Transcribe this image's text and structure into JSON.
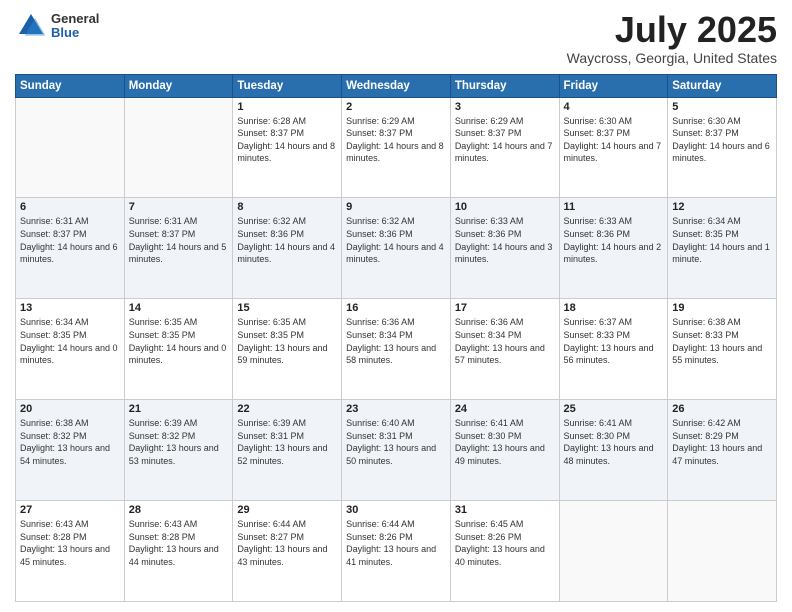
{
  "logo": {
    "general": "General",
    "blue": "Blue"
  },
  "header": {
    "title": "July 2025",
    "subtitle": "Waycross, Georgia, United States"
  },
  "weekdays": [
    "Sunday",
    "Monday",
    "Tuesday",
    "Wednesday",
    "Thursday",
    "Friday",
    "Saturday"
  ],
  "days": [
    {
      "num": "",
      "sunrise": "",
      "sunset": "",
      "daylight": ""
    },
    {
      "num": "",
      "sunrise": "",
      "sunset": "",
      "daylight": ""
    },
    {
      "num": "1",
      "sunrise": "Sunrise: 6:28 AM",
      "sunset": "Sunset: 8:37 PM",
      "daylight": "Daylight: 14 hours and 8 minutes."
    },
    {
      "num": "2",
      "sunrise": "Sunrise: 6:29 AM",
      "sunset": "Sunset: 8:37 PM",
      "daylight": "Daylight: 14 hours and 8 minutes."
    },
    {
      "num": "3",
      "sunrise": "Sunrise: 6:29 AM",
      "sunset": "Sunset: 8:37 PM",
      "daylight": "Daylight: 14 hours and 7 minutes."
    },
    {
      "num": "4",
      "sunrise": "Sunrise: 6:30 AM",
      "sunset": "Sunset: 8:37 PM",
      "daylight": "Daylight: 14 hours and 7 minutes."
    },
    {
      "num": "5",
      "sunrise": "Sunrise: 6:30 AM",
      "sunset": "Sunset: 8:37 PM",
      "daylight": "Daylight: 14 hours and 6 minutes."
    },
    {
      "num": "6",
      "sunrise": "Sunrise: 6:31 AM",
      "sunset": "Sunset: 8:37 PM",
      "daylight": "Daylight: 14 hours and 6 minutes."
    },
    {
      "num": "7",
      "sunrise": "Sunrise: 6:31 AM",
      "sunset": "Sunset: 8:37 PM",
      "daylight": "Daylight: 14 hours and 5 minutes."
    },
    {
      "num": "8",
      "sunrise": "Sunrise: 6:32 AM",
      "sunset": "Sunset: 8:36 PM",
      "daylight": "Daylight: 14 hours and 4 minutes."
    },
    {
      "num": "9",
      "sunrise": "Sunrise: 6:32 AM",
      "sunset": "Sunset: 8:36 PM",
      "daylight": "Daylight: 14 hours and 4 minutes."
    },
    {
      "num": "10",
      "sunrise": "Sunrise: 6:33 AM",
      "sunset": "Sunset: 8:36 PM",
      "daylight": "Daylight: 14 hours and 3 minutes."
    },
    {
      "num": "11",
      "sunrise": "Sunrise: 6:33 AM",
      "sunset": "Sunset: 8:36 PM",
      "daylight": "Daylight: 14 hours and 2 minutes."
    },
    {
      "num": "12",
      "sunrise": "Sunrise: 6:34 AM",
      "sunset": "Sunset: 8:35 PM",
      "daylight": "Daylight: 14 hours and 1 minute."
    },
    {
      "num": "13",
      "sunrise": "Sunrise: 6:34 AM",
      "sunset": "Sunset: 8:35 PM",
      "daylight": "Daylight: 14 hours and 0 minutes."
    },
    {
      "num": "14",
      "sunrise": "Sunrise: 6:35 AM",
      "sunset": "Sunset: 8:35 PM",
      "daylight": "Daylight: 14 hours and 0 minutes."
    },
    {
      "num": "15",
      "sunrise": "Sunrise: 6:35 AM",
      "sunset": "Sunset: 8:35 PM",
      "daylight": "Daylight: 13 hours and 59 minutes."
    },
    {
      "num": "16",
      "sunrise": "Sunrise: 6:36 AM",
      "sunset": "Sunset: 8:34 PM",
      "daylight": "Daylight: 13 hours and 58 minutes."
    },
    {
      "num": "17",
      "sunrise": "Sunrise: 6:36 AM",
      "sunset": "Sunset: 8:34 PM",
      "daylight": "Daylight: 13 hours and 57 minutes."
    },
    {
      "num": "18",
      "sunrise": "Sunrise: 6:37 AM",
      "sunset": "Sunset: 8:33 PM",
      "daylight": "Daylight: 13 hours and 56 minutes."
    },
    {
      "num": "19",
      "sunrise": "Sunrise: 6:38 AM",
      "sunset": "Sunset: 8:33 PM",
      "daylight": "Daylight: 13 hours and 55 minutes."
    },
    {
      "num": "20",
      "sunrise": "Sunrise: 6:38 AM",
      "sunset": "Sunset: 8:32 PM",
      "daylight": "Daylight: 13 hours and 54 minutes."
    },
    {
      "num": "21",
      "sunrise": "Sunrise: 6:39 AM",
      "sunset": "Sunset: 8:32 PM",
      "daylight": "Daylight: 13 hours and 53 minutes."
    },
    {
      "num": "22",
      "sunrise": "Sunrise: 6:39 AM",
      "sunset": "Sunset: 8:31 PM",
      "daylight": "Daylight: 13 hours and 52 minutes."
    },
    {
      "num": "23",
      "sunrise": "Sunrise: 6:40 AM",
      "sunset": "Sunset: 8:31 PM",
      "daylight": "Daylight: 13 hours and 50 minutes."
    },
    {
      "num": "24",
      "sunrise": "Sunrise: 6:41 AM",
      "sunset": "Sunset: 8:30 PM",
      "daylight": "Daylight: 13 hours and 49 minutes."
    },
    {
      "num": "25",
      "sunrise": "Sunrise: 6:41 AM",
      "sunset": "Sunset: 8:30 PM",
      "daylight": "Daylight: 13 hours and 48 minutes."
    },
    {
      "num": "26",
      "sunrise": "Sunrise: 6:42 AM",
      "sunset": "Sunset: 8:29 PM",
      "daylight": "Daylight: 13 hours and 47 minutes."
    },
    {
      "num": "27",
      "sunrise": "Sunrise: 6:43 AM",
      "sunset": "Sunset: 8:28 PM",
      "daylight": "Daylight: 13 hours and 45 minutes."
    },
    {
      "num": "28",
      "sunrise": "Sunrise: 6:43 AM",
      "sunset": "Sunset: 8:28 PM",
      "daylight": "Daylight: 13 hours and 44 minutes."
    },
    {
      "num": "29",
      "sunrise": "Sunrise: 6:44 AM",
      "sunset": "Sunset: 8:27 PM",
      "daylight": "Daylight: 13 hours and 43 minutes."
    },
    {
      "num": "30",
      "sunrise": "Sunrise: 6:44 AM",
      "sunset": "Sunset: 8:26 PM",
      "daylight": "Daylight: 13 hours and 41 minutes."
    },
    {
      "num": "31",
      "sunrise": "Sunrise: 6:45 AM",
      "sunset": "Sunset: 8:26 PM",
      "daylight": "Daylight: 13 hours and 40 minutes."
    },
    {
      "num": "",
      "sunrise": "",
      "sunset": "",
      "daylight": ""
    },
    {
      "num": "",
      "sunrise": "",
      "sunset": "",
      "daylight": ""
    }
  ]
}
